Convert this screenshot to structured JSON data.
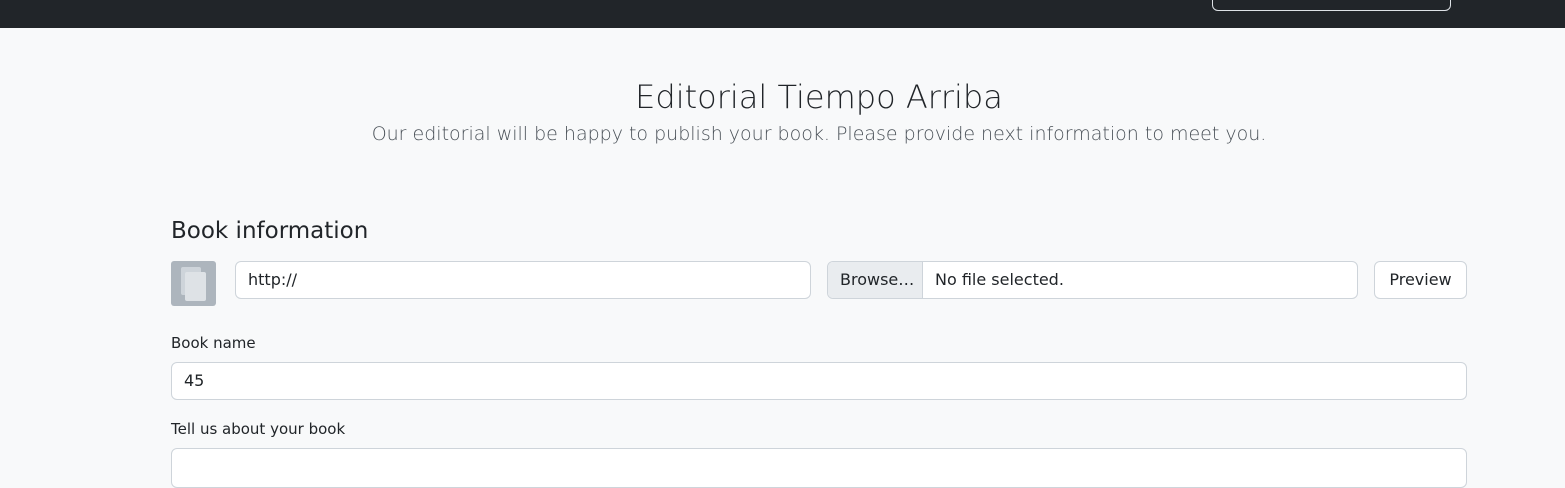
{
  "header": {
    "title": "Editorial Tiempo Arriba",
    "subtitle": "Our editorial will be happy to publish your book. Please provide next information to meet you."
  },
  "book_info": {
    "section_title": "Book information",
    "cover_url_value": "http://",
    "browse_label": "Browse…",
    "file_status": "No file selected.",
    "preview_label": "Preview",
    "book_name_label": "Book name",
    "book_name_value": "45",
    "about_label": "Tell us about your book"
  },
  "colors": {
    "topbar": "#212529",
    "background": "#f8f9fa",
    "cover_placeholder": "#adb5bd"
  },
  "icons": {
    "cover_placeholder": "image-placeholder-icon"
  }
}
